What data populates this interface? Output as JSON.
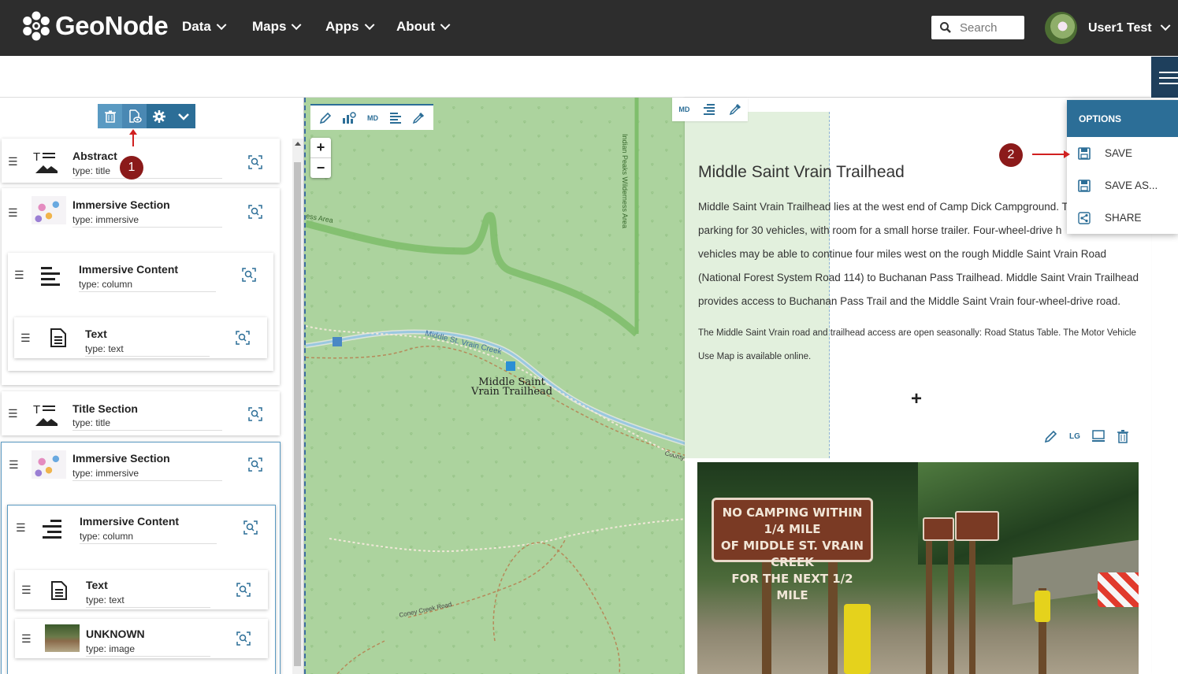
{
  "header": {
    "logo": "GeoNode",
    "nav": [
      {
        "label": "Data"
      },
      {
        "label": "Maps"
      },
      {
        "label": "Apps"
      },
      {
        "label": "About"
      }
    ],
    "search_placeholder": "Search",
    "user_name": "User1 Test"
  },
  "tree": {
    "nodes": [
      {
        "title": "Abstract",
        "type": "type: title"
      },
      {
        "title": "Immersive Section",
        "type": "type: immersive"
      },
      {
        "title": "Immersive Content",
        "type": "type: column"
      },
      {
        "title": "Text",
        "type": "type: text"
      },
      {
        "title": "Title Section",
        "type": "type: title"
      },
      {
        "title": "Immersive Section",
        "type": "type: immersive"
      },
      {
        "title": "Immersive Content",
        "type": "type: column"
      },
      {
        "title": "Text",
        "type": "type: text"
      },
      {
        "title": "UNKNOWN",
        "type": "type: image"
      }
    ]
  },
  "map": {
    "tool_md": "MD",
    "labels": {
      "trailhead": "Middle Saint\nVrain Trailhead",
      "creek": "Middle St. Vrain Creek",
      "wilderness": "Indian Peaks Wilderness Area",
      "area": "ess Area",
      "road": "Coney Creek Road",
      "county": "County Road"
    }
  },
  "content": {
    "tool_md": "MD",
    "title": "Middle Saint Vrain Trailhead",
    "paragraph_lines": [
      "Middle Saint Vrain Trailhead lies at the west end of Camp Dick Campground. T",
      "parking for 30 vehicles, with room for a small horse trailer. Four-wheel-drive h",
      "vehicles may be able to continue four miles west on the rough Middle Saint Vrain Road",
      "(National Forest System Road 114) to Buchanan Pass Trailhead. Middle Saint Vrain Trailhead",
      "provides access to Buchanan Pass Trail and the Middle Saint Vrain four-wheel-drive road."
    ],
    "small_lines": [
      "The Middle Saint Vrain road and trailhead access are open seasonally: Road Status Table. The Motor Vehicle",
      "Use Map is available online."
    ],
    "add_symbol": "+",
    "image_tool_lg": "LG",
    "photo_sign": [
      "NO CAMPING WITHIN 1/4 MILE",
      "OF MIDDLE ST. VRAIN CREEK",
      "FOR THE NEXT 1/2 MILE"
    ]
  },
  "options": {
    "heading": "OPTIONS",
    "items": [
      {
        "label": "SAVE"
      },
      {
        "label": "SAVE AS..."
      },
      {
        "label": "SHARE"
      }
    ]
  },
  "annotations": {
    "badge1": "1",
    "badge2": "2"
  },
  "colors": {
    "primary": "#2c6e97",
    "header_bg": "#2d2d2d",
    "badge": "#8b1a1a",
    "map_bg": "#acd39e"
  }
}
